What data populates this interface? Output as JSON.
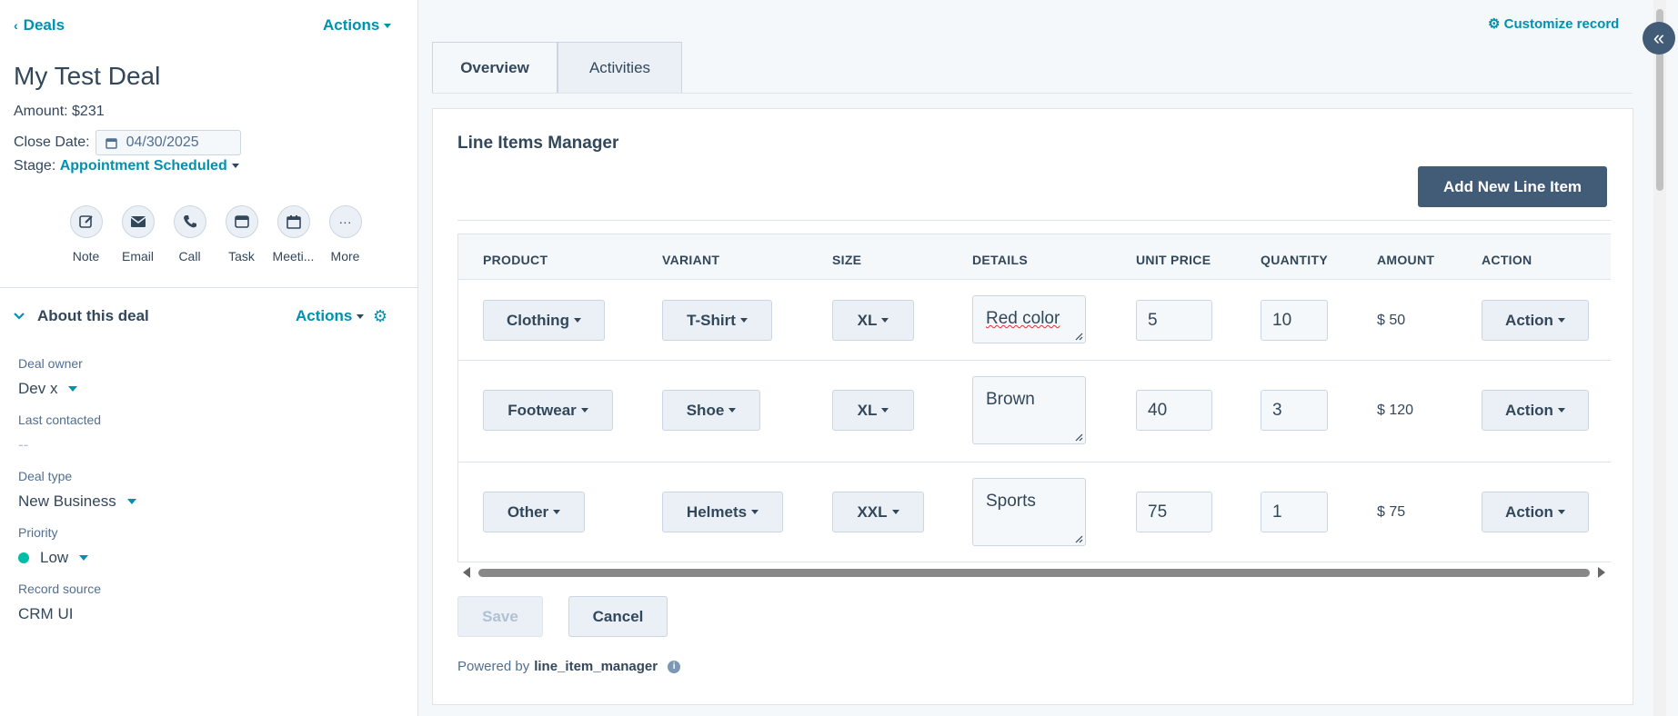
{
  "left": {
    "back_label": "Deals",
    "actions_label": "Actions",
    "title": "My Test Deal",
    "amount": "Amount: $231",
    "close_date_label": "Close Date:",
    "close_date_value": "04/30/2025",
    "stage_label": "Stage:",
    "stage_value": "Appointment Scheduled",
    "quick_actions": [
      {
        "label": "Note",
        "icon": "note-edit-icon"
      },
      {
        "label": "Email",
        "icon": "email-icon"
      },
      {
        "label": "Call",
        "icon": "phone-icon"
      },
      {
        "label": "Task",
        "icon": "task-icon"
      },
      {
        "label": "Meeti...",
        "icon": "calendar-icon"
      },
      {
        "label": "More",
        "icon": "more-dots-icon"
      }
    ]
  },
  "about": {
    "title": "About this deal",
    "actions_label": "Actions",
    "props": [
      {
        "label": "Deal owner",
        "value": "Dev x"
      },
      {
        "label": "Last contacted",
        "value": "--"
      },
      {
        "label": "Deal type",
        "value": "New Business"
      },
      {
        "label": "Priority",
        "value": "Low"
      },
      {
        "label": "Record source",
        "value": "CRM UI"
      }
    ]
  },
  "main": {
    "customize_label": "Customize record",
    "tabs": [
      {
        "label": "Overview"
      },
      {
        "label": "Activities"
      }
    ],
    "card_title": "Line Items Manager",
    "add_button": "Add New Line Item",
    "columns": [
      "PRODUCT",
      "VARIANT",
      "SIZE",
      "DETAILS",
      "UNIT PRICE",
      "QUANTITY",
      "AMOUNT",
      "ACTION"
    ],
    "rows": [
      {
        "product": "Clothing",
        "variant": "T-Shirt",
        "size": "XL",
        "details": "Red color",
        "unit_price": "5",
        "quantity": "10",
        "amount": "$ 50",
        "action": "Action"
      },
      {
        "product": "Footwear",
        "variant": "Shoe",
        "size": "XL",
        "details": "Brown",
        "unit_price": "40",
        "quantity": "3",
        "amount": "$ 120",
        "action": "Action"
      },
      {
        "product": "Other",
        "variant": "Helmets",
        "size": "XXL",
        "details": "Sports",
        "unit_price": "75",
        "quantity": "1",
        "amount": "$ 75",
        "action": "Action"
      }
    ],
    "save_label": "Save",
    "cancel_label": "Cancel",
    "powered_by_prefix": "Powered by",
    "powered_by_name": "line_item_manager"
  },
  "colors": {
    "accent": "#0091ae",
    "primary_button": "#425b76",
    "priority_dot": "#00bda5"
  }
}
